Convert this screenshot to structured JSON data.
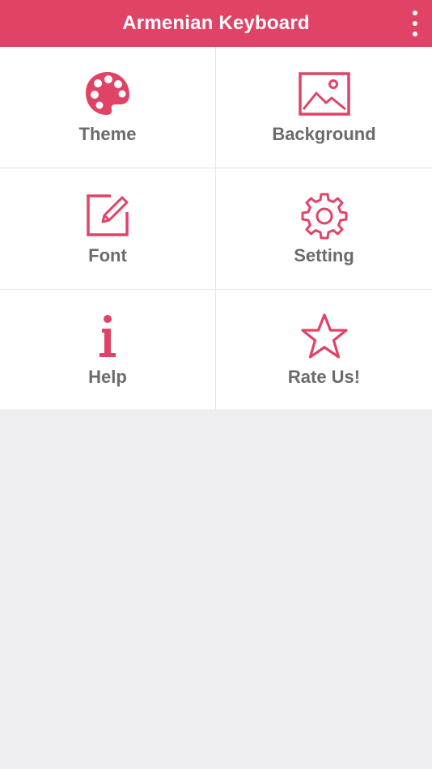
{
  "appbar": {
    "title": "Armenian Keyboard",
    "menu_icon": "more-vertical-icon"
  },
  "colors": {
    "accent": "#e04366",
    "label": "#6b6b6b",
    "background": "#efeef3"
  },
  "menu": [
    {
      "label": "Theme",
      "icon": "palette-icon"
    },
    {
      "label": "Background",
      "icon": "image-icon"
    },
    {
      "label": "Font",
      "icon": "edit-icon"
    },
    {
      "label": "Setting",
      "icon": "gear-icon"
    },
    {
      "label": "Help",
      "icon": "info-icon"
    },
    {
      "label": "Rate Us!",
      "icon": "star-icon"
    }
  ]
}
